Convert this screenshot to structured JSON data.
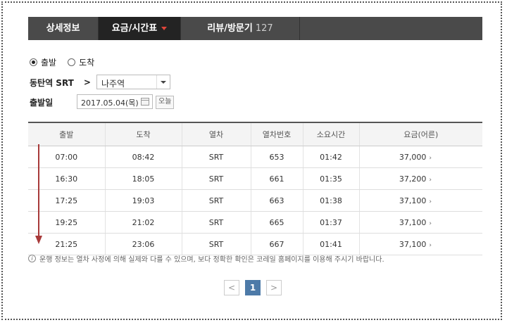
{
  "tabs": [
    {
      "label": "상세정보",
      "count": ""
    },
    {
      "label": "요금/시간표",
      "count": ""
    },
    {
      "label": "리뷰/방문기",
      "count": "127"
    }
  ],
  "direction": {
    "depart_label": "출발",
    "arrive_label": "도착",
    "selected": "depart"
  },
  "route": {
    "from": "동탄역 SRT",
    "arrow": ">",
    "to_value": "나주역"
  },
  "date": {
    "label": "출발일",
    "value": "2017.05.04(목)",
    "today_button": "오늘"
  },
  "table": {
    "headers": [
      "출발",
      "도착",
      "열차",
      "열차번호",
      "소요시간",
      "요금(어른)"
    ],
    "rows": [
      {
        "depart": "07:00",
        "arrive": "08:42",
        "train": "SRT",
        "number": "653",
        "duration": "01:42",
        "fare": "37,000"
      },
      {
        "depart": "16:30",
        "arrive": "18:05",
        "train": "SRT",
        "number": "661",
        "duration": "01:35",
        "fare": "37,200"
      },
      {
        "depart": "17:25",
        "arrive": "19:03",
        "train": "SRT",
        "number": "663",
        "duration": "01:38",
        "fare": "37,100"
      },
      {
        "depart": "19:25",
        "arrive": "21:02",
        "train": "SRT",
        "number": "665",
        "duration": "01:37",
        "fare": "37,100"
      },
      {
        "depart": "21:25",
        "arrive": "23:06",
        "train": "SRT",
        "number": "667",
        "duration": "01:41",
        "fare": "37,100"
      }
    ]
  },
  "notice": "운행 정보는 열차 사정에 의해 실제와 다를 수 있으며, 보다 정확한 확인은 코레일 홈페이지를 이용해 주시기 바랍니다.",
  "pagination": {
    "prev": "<",
    "current": "1",
    "next": ">"
  },
  "colors": {
    "tab_bg": "#4a4a4a",
    "tab_active_bg": "#232323",
    "caret": "#e0453a",
    "page_active": "#4d7aa8",
    "annotation_arrow": "#a83a3a"
  }
}
